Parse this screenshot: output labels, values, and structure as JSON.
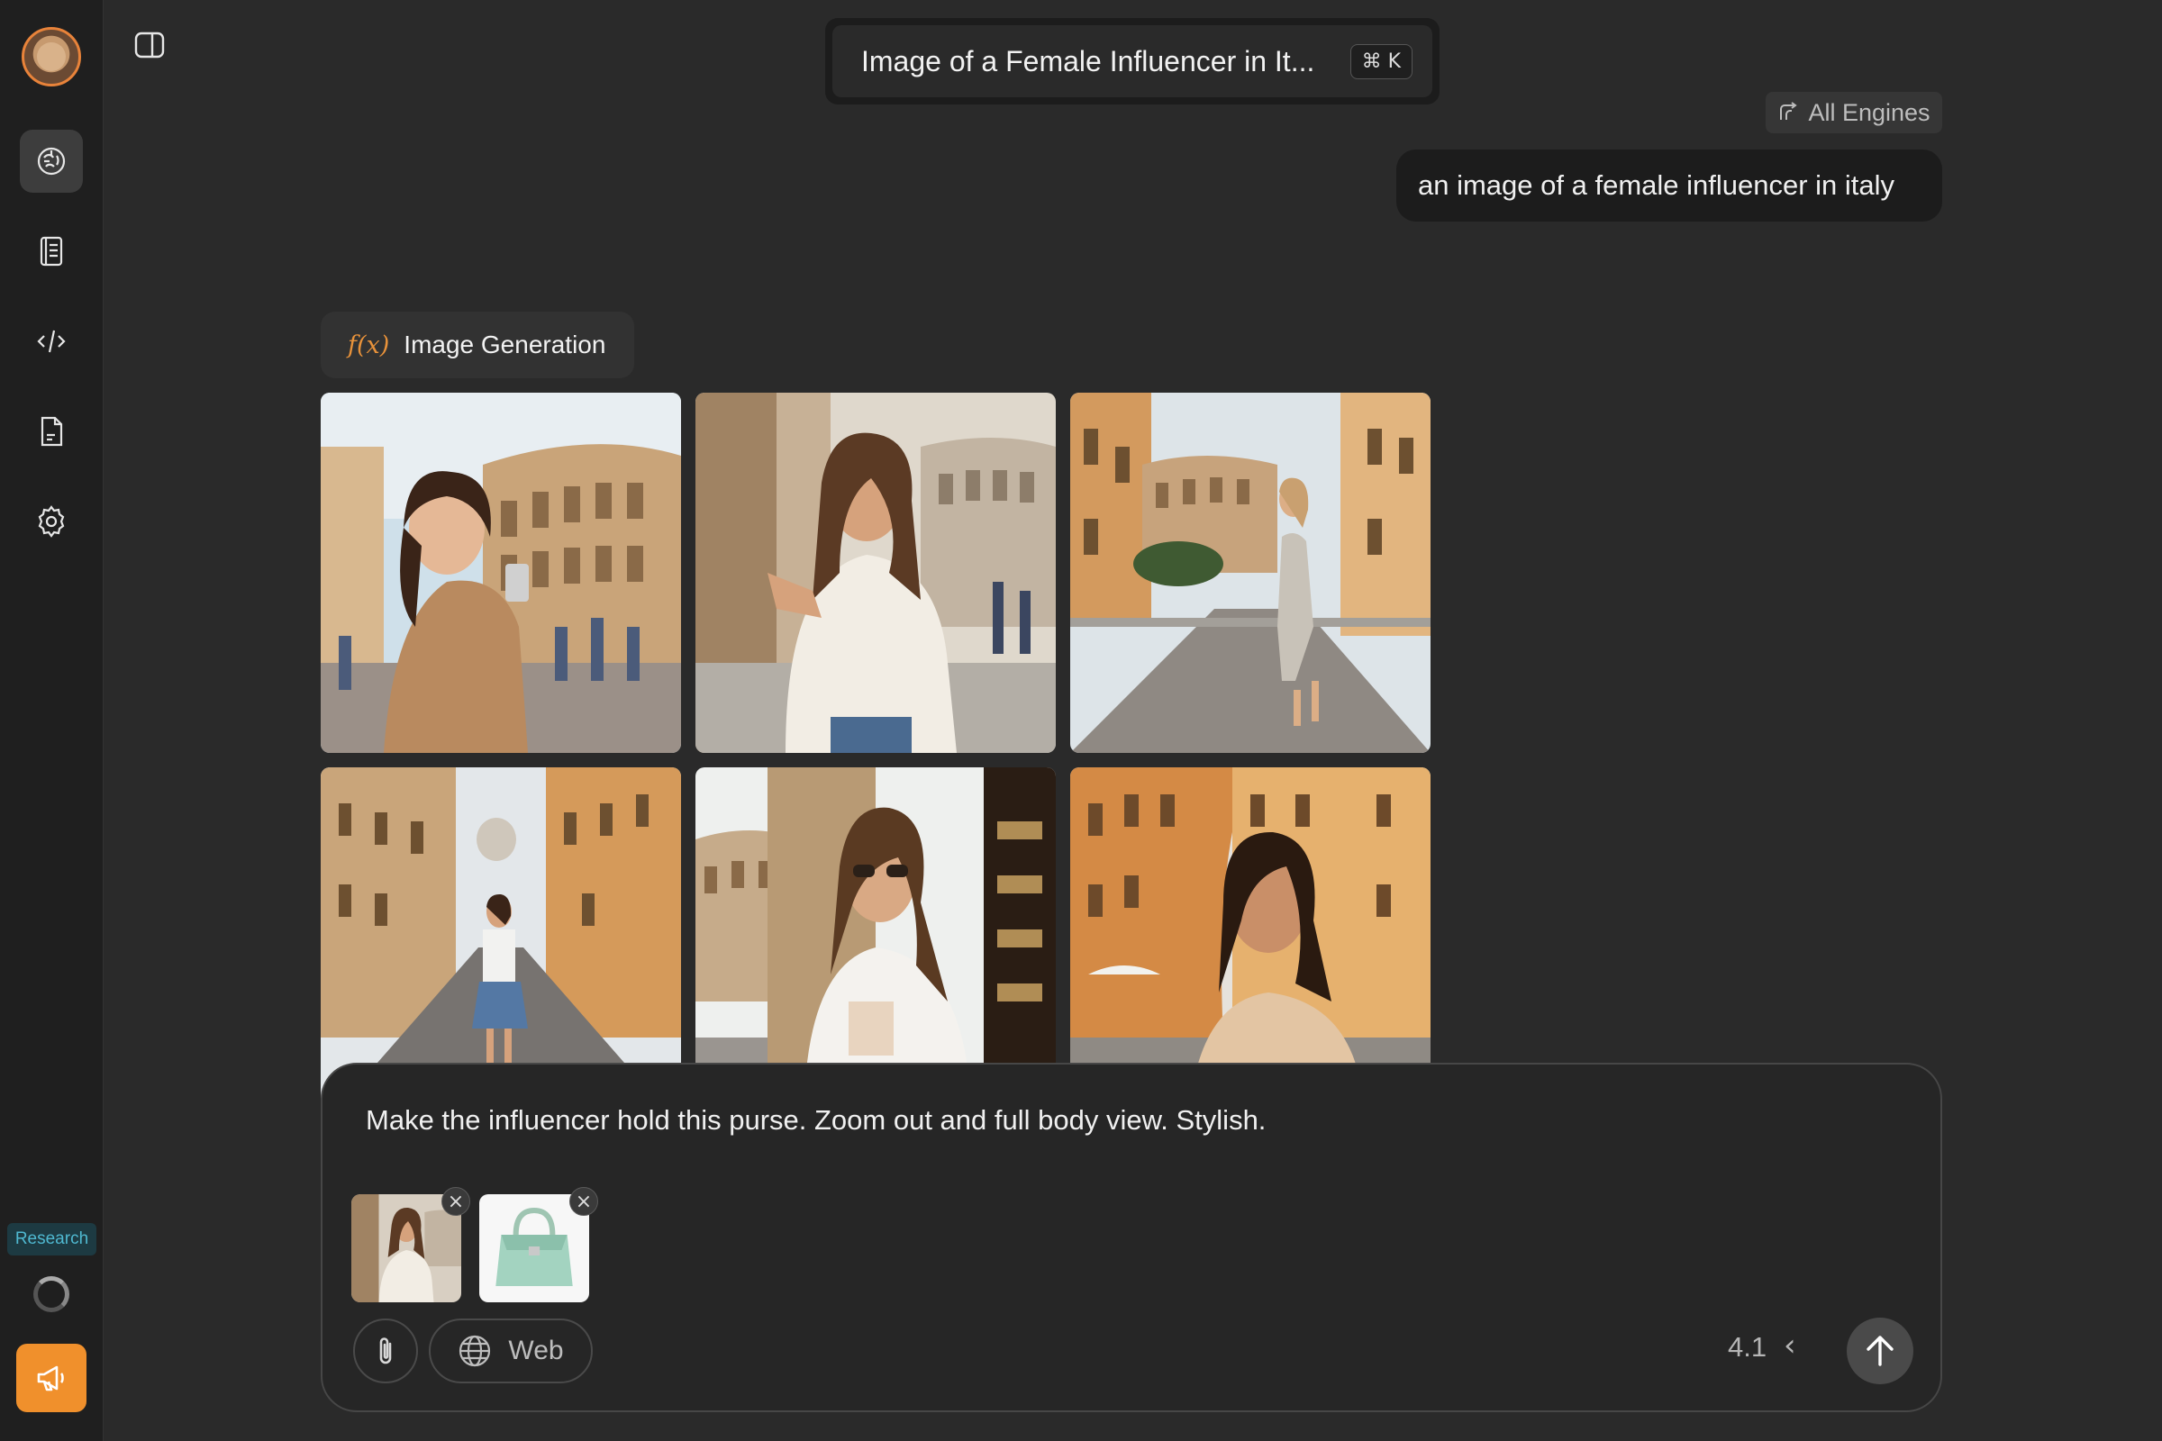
{
  "sidebar": {
    "avatar_icon": "bear-avatar-icon",
    "nav_items": [
      {
        "icon": "brain-icon",
        "active": true
      },
      {
        "icon": "notebook-icon",
        "active": false
      },
      {
        "icon": "code-pen-icon",
        "active": false
      },
      {
        "icon": "document-icon",
        "active": false
      },
      {
        "icon": "gear-icon",
        "active": false
      }
    ],
    "research_badge": "Research",
    "megaphone_icon": "megaphone-icon"
  },
  "header": {
    "conversation_title": "Image of a Female Influencer in It...",
    "shortcut": "⌘ K"
  },
  "engines": {
    "label": "All Engines"
  },
  "user_message": "an image of a female influencer in italy",
  "tool": {
    "icon": "f(x)",
    "label": "Image Generation"
  },
  "images": [
    {
      "alt": "Woman with phone in front of the Colosseum"
    },
    {
      "alt": "Woman leaning on a stone wall near the Colosseum"
    },
    {
      "alt": "Woman walking on cobblestone street toward the Colosseum"
    },
    {
      "alt": "Woman in denim skirt on a Roman street"
    },
    {
      "alt": "Woman in white blazer with sunglasses near the Colosseum"
    },
    {
      "alt": "Woman smiling in an orange-walled Roman piazza"
    }
  ],
  "composer": {
    "text": "Make the influencer hold this purse. Zoom out and full body view. Stylish.",
    "attachments": [
      {
        "alt": "influencer image attachment"
      },
      {
        "alt": "mint green handbag attachment"
      }
    ],
    "web_label": "Web",
    "version": "4.1"
  },
  "colors": {
    "accent": "#f0902c",
    "background": "#2a2a2a",
    "sidebar": "#1f1f1f"
  }
}
